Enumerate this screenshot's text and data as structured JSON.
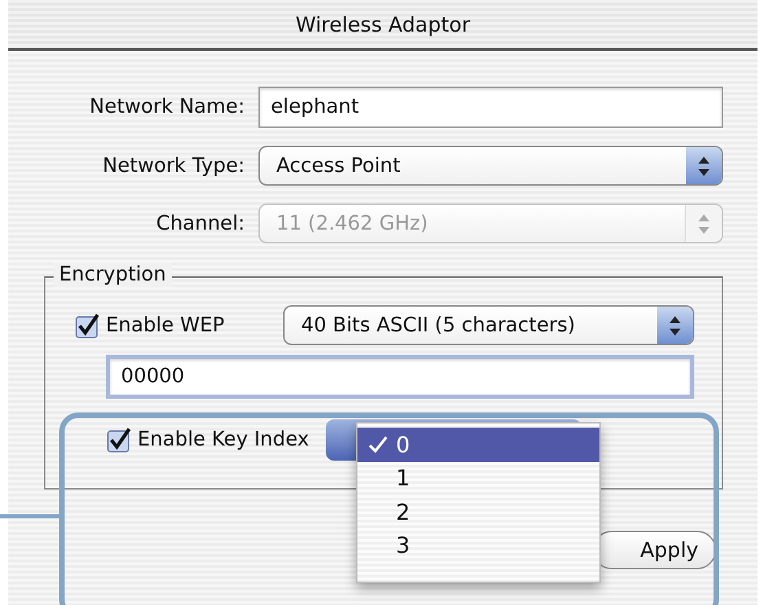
{
  "window": {
    "title": "Wireless Adaptor"
  },
  "network_name": {
    "label": "Network Name:",
    "value": "elephant"
  },
  "network_type": {
    "label": "Network Type:",
    "value": "Access Point",
    "disabled": false
  },
  "channel": {
    "label": "Channel:",
    "value": "11 (2.462 GHz)",
    "disabled": true
  },
  "encryption": {
    "title": "Encryption",
    "enable_wep": {
      "label": "Enable WEP",
      "checked": true
    },
    "wep_mode": {
      "value": "40 Bits ASCII (5 characters)",
      "disabled": false
    },
    "key": {
      "value": "00000"
    },
    "enable_key_index": {
      "label": "Enable Key Index",
      "checked": true
    },
    "key_index_menu": {
      "items": [
        {
          "label": "0",
          "selected": true
        },
        {
          "label": "1",
          "selected": false
        },
        {
          "label": "2",
          "selected": false
        },
        {
          "label": "3",
          "selected": false
        }
      ]
    }
  },
  "buttons": [
    {
      "label": "Apply"
    }
  ]
}
